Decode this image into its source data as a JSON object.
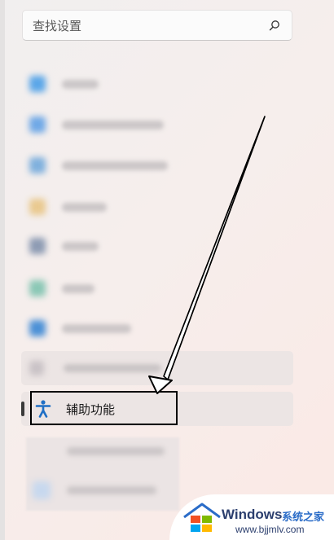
{
  "search": {
    "placeholder": "查找设置",
    "icon": "search-icon"
  },
  "nav_blurred": [
    {
      "icon_color": "#5aa6e8"
    },
    {
      "icon_color": "#6fa8e6"
    },
    {
      "icon_color": "#7fb0dd"
    },
    {
      "icon_color": "#e9c98f"
    },
    {
      "icon_color": "#8d9bb3"
    },
    {
      "icon_color": "#8ac7b5"
    },
    {
      "icon_color": "#4b90d6"
    }
  ],
  "selected_item": {
    "label": "辅助功能",
    "icon": "accessibility-icon",
    "icon_color": "#1f6fc5"
  },
  "watermark": {
    "title": "Windows",
    "subtitle": "系统之家",
    "url": "www.bjjmlv.com"
  }
}
